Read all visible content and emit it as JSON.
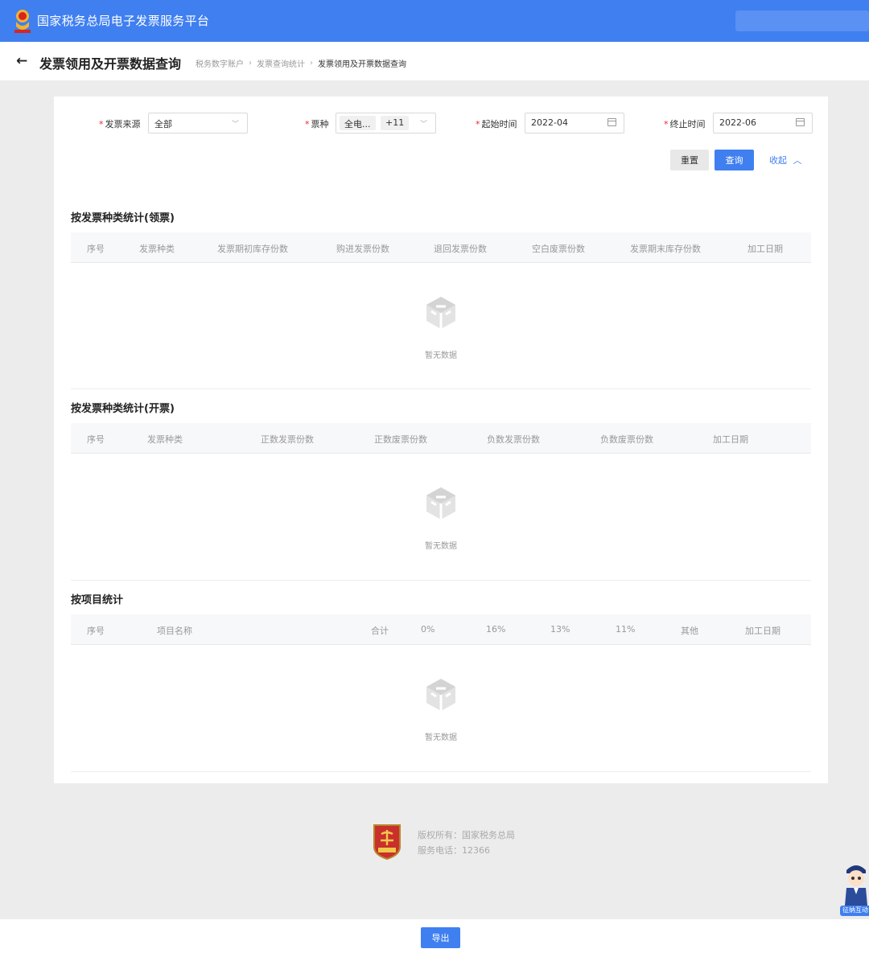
{
  "header": {
    "site_title": "国家税务总局电子发票服务平台",
    "brand_color": "#3f7ff0"
  },
  "titlebar": {
    "title": "发票领用及开票数据查询",
    "breadcrumb": [
      "税务数字账户",
      "发票查询统计",
      "发票领用及开票数据查询"
    ]
  },
  "filters": {
    "source": {
      "label": "发票来源",
      "value": "全部"
    },
    "type": {
      "label": "票种",
      "tag": "全电...",
      "more": "+11"
    },
    "start": {
      "label": "起始时间",
      "value": "2022-04"
    },
    "end": {
      "label": "终止时间",
      "value": "2022-06"
    },
    "reset_label": "重置",
    "query_label": "查询",
    "collapse_label": "收起"
  },
  "sections": [
    {
      "title": "按发票种类统计(领票)",
      "columns": [
        "序号",
        "发票种类",
        "发票期初库存份数",
        "购进发票份数",
        "退回发票份数",
        "空白废票份数",
        "发票期末库存份数",
        "加工日期"
      ],
      "empty_text": "暂无数据"
    },
    {
      "title": "按发票种类统计(开票)",
      "columns": [
        "序号",
        "发票种类",
        "正数发票份数",
        "正数废票份数",
        "负数发票份数",
        "负数废票份数",
        "加工日期"
      ],
      "empty_text": "暂无数据"
    },
    {
      "title": "按项目统计",
      "columns": [
        "序号",
        "项目名称",
        "合计",
        "0%",
        "16%",
        "13%",
        "11%",
        "其他",
        "加工日期"
      ],
      "empty_text": "暂无数据"
    }
  ],
  "footer": {
    "logo_text": "税徽",
    "copyright": "版权所有：国家税务总局",
    "phone": "服务电话：12366"
  },
  "assistant": {
    "label": "征纳互动"
  },
  "export_label": "导出"
}
